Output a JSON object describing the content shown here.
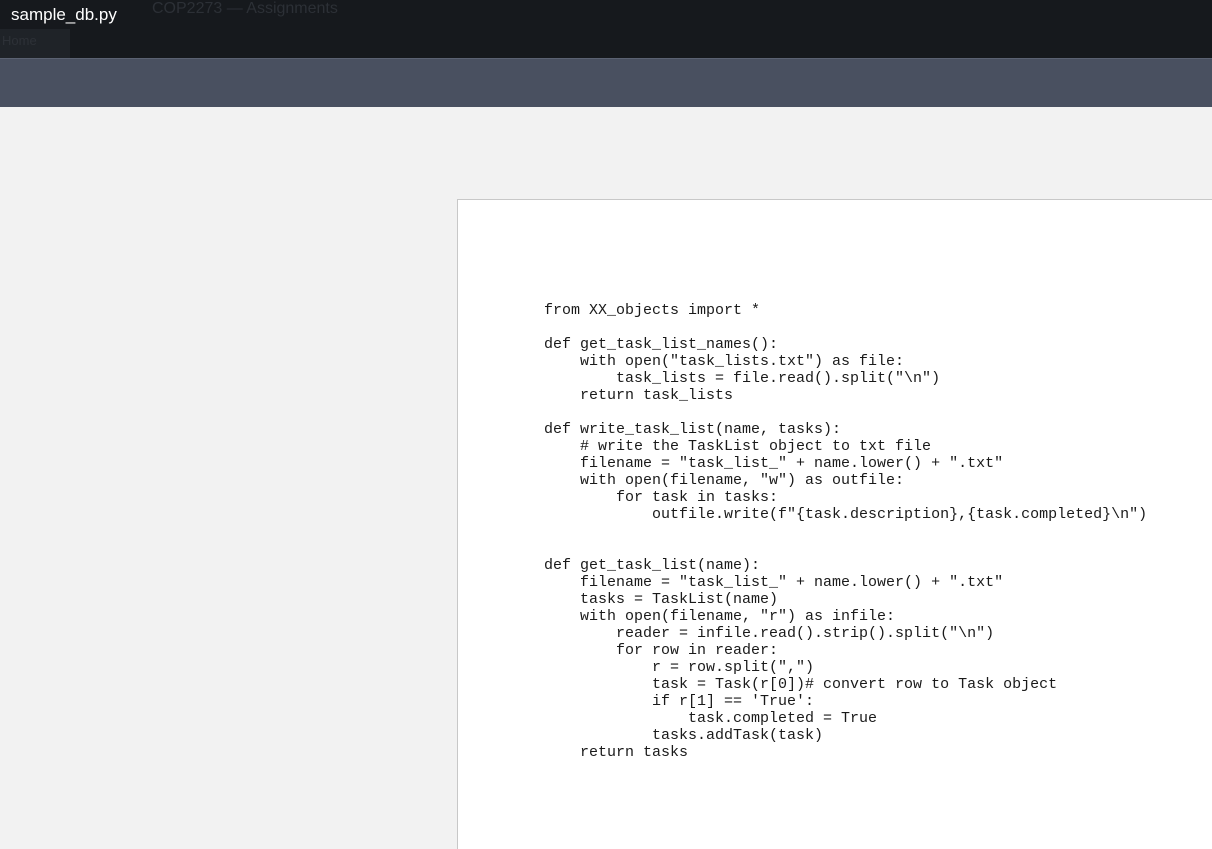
{
  "window": {
    "file_title": "sample_db.py",
    "background_course": "COP2273 — Assignments",
    "background_home": "Home"
  },
  "document": {
    "code": "from XX_objects import *\n\ndef get_task_list_names():\n    with open(\"task_lists.txt\") as file:\n        task_lists = file.read().split(\"\\n\")\n    return task_lists\n\ndef write_task_list(name, tasks):\n    # write the TaskList object to txt file\n    filename = \"task_list_\" + name.lower() + \".txt\"\n    with open(filename, \"w\") as outfile:\n        for task in tasks:\n            outfile.write(f\"{task.description},{task.completed}\\n\")\n\n\ndef get_task_list(name):\n    filename = \"task_list_\" + name.lower() + \".txt\"\n    tasks = TaskList(name)\n    with open(filename, \"r\") as infile:\n        reader = infile.read().strip().split(\"\\n\")\n        for row in reader:\n            r = row.split(\",\")\n            task = Task(r[0])# convert row to Task object\n            if r[1] == 'True':\n                task.completed = True\n            tasks.addTask(task)\n    return tasks"
  },
  "colors": {
    "titlebar_bg": "#16191d",
    "toolbar_bg": "#495060",
    "viewer_bg": "#f2f2f2",
    "page_bg": "#ffffff"
  }
}
